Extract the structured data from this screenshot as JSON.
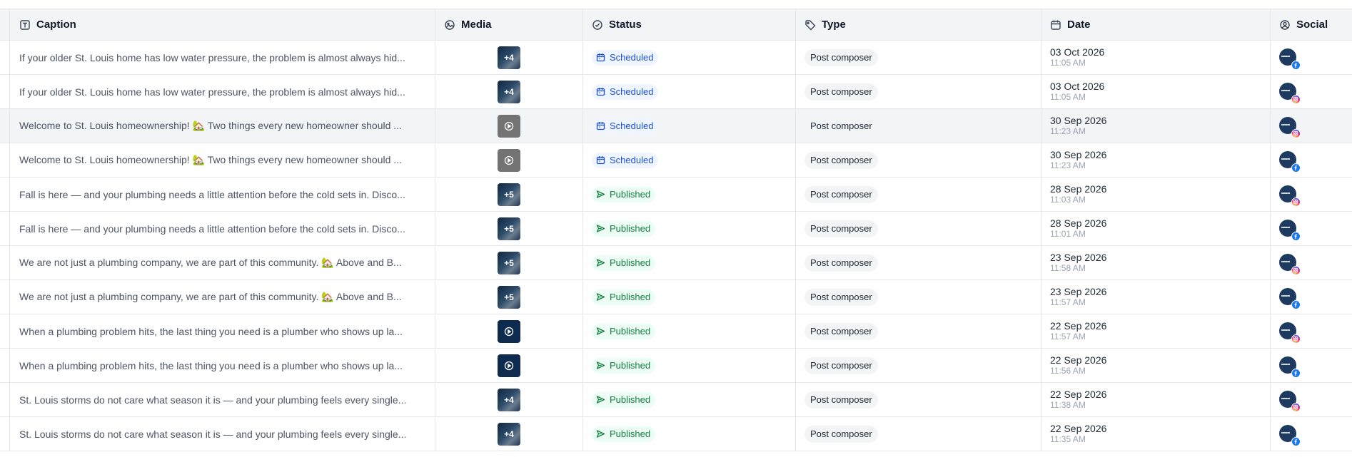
{
  "headers": {
    "caption": "Caption",
    "media": "Media",
    "status": "Status",
    "type": "Type",
    "date": "Date",
    "social": "Social"
  },
  "icons": {
    "caption": "text-icon",
    "media": "image-icon",
    "status": "check-circle-icon",
    "type": "tag-icon",
    "date": "calendar-icon",
    "social": "user-circle-icon"
  },
  "colors": {
    "scheduled": "#1d4ed8",
    "published": "#15803d",
    "facebook": "#1877f2",
    "instagram": "#d6249f"
  },
  "rows": [
    {
      "caption": "If your older St. Louis home has low water pressure, the problem is almost always hid...",
      "media": "photo",
      "media_count": "+4",
      "status": "Scheduled",
      "type": "Post composer",
      "date": "03 Oct 2026",
      "time": "11:05 AM",
      "social": "facebook"
    },
    {
      "caption": "If your older St. Louis home has low water pressure, the problem is almost always hid...",
      "media": "photo",
      "media_count": "+4",
      "status": "Scheduled",
      "type": "Post composer",
      "date": "03 Oct 2026",
      "time": "11:05 AM",
      "social": "instagram"
    },
    {
      "caption": "Welcome to St. Louis homeownership! 🏡 Two things every new homeowner should ...",
      "media": "video-gray",
      "media_count": "",
      "status": "Scheduled",
      "type": "Post composer",
      "date": "30 Sep 2026",
      "time": "11:23 AM",
      "social": "instagram",
      "highlighted": true
    },
    {
      "caption": "Welcome to St. Louis homeownership! 🏡 Two things every new homeowner should ...",
      "media": "video-gray",
      "media_count": "",
      "status": "Scheduled",
      "type": "Post composer",
      "date": "30 Sep 2026",
      "time": "11:23 AM",
      "social": "facebook"
    },
    {
      "caption": "Fall is here — and your plumbing needs a little attention before the cold sets in. Disco...",
      "media": "photo",
      "media_count": "+5",
      "status": "Published",
      "type": "Post composer",
      "date": "28 Sep 2026",
      "time": "11:03 AM",
      "social": "instagram"
    },
    {
      "caption": "Fall is here — and your plumbing needs a little attention before the cold sets in. Disco...",
      "media": "photo",
      "media_count": "+5",
      "status": "Published",
      "type": "Post composer",
      "date": "28 Sep 2026",
      "time": "11:01 AM",
      "social": "facebook"
    },
    {
      "caption": "We are not just a plumbing company, we are part of this community. 🏡 Above and B...",
      "media": "photo",
      "media_count": "+5",
      "status": "Published",
      "type": "Post composer",
      "date": "23 Sep 2026",
      "time": "11:58 AM",
      "social": "instagram"
    },
    {
      "caption": "We are not just a plumbing company, we are part of this community. 🏡 Above and B...",
      "media": "photo",
      "media_count": "+5",
      "status": "Published",
      "type": "Post composer",
      "date": "23 Sep 2026",
      "time": "11:57 AM",
      "social": "facebook"
    },
    {
      "caption": "When a plumbing problem hits, the last thing you need is a plumber who shows up la...",
      "media": "video-navy",
      "media_count": "",
      "status": "Published",
      "type": "Post composer",
      "date": "22 Sep 2026",
      "time": "11:57 AM",
      "social": "instagram"
    },
    {
      "caption": "When a plumbing problem hits, the last thing you need is a plumber who shows up la...",
      "media": "video-navy",
      "media_count": "",
      "status": "Published",
      "type": "Post composer",
      "date": "22 Sep 2026",
      "time": "11:56 AM",
      "social": "facebook"
    },
    {
      "caption": "St. Louis storms do not care what season it is — and your plumbing feels every single...",
      "media": "photo",
      "media_count": "+4",
      "status": "Published",
      "type": "Post composer",
      "date": "22 Sep 2026",
      "time": "11:38 AM",
      "social": "instagram"
    },
    {
      "caption": "St. Louis storms do not care what season it is — and your plumbing feels every single...",
      "media": "photo",
      "media_count": "+4",
      "status": "Published",
      "type": "Post composer",
      "date": "22 Sep 2026",
      "time": "11:35 AM",
      "social": "facebook"
    }
  ]
}
